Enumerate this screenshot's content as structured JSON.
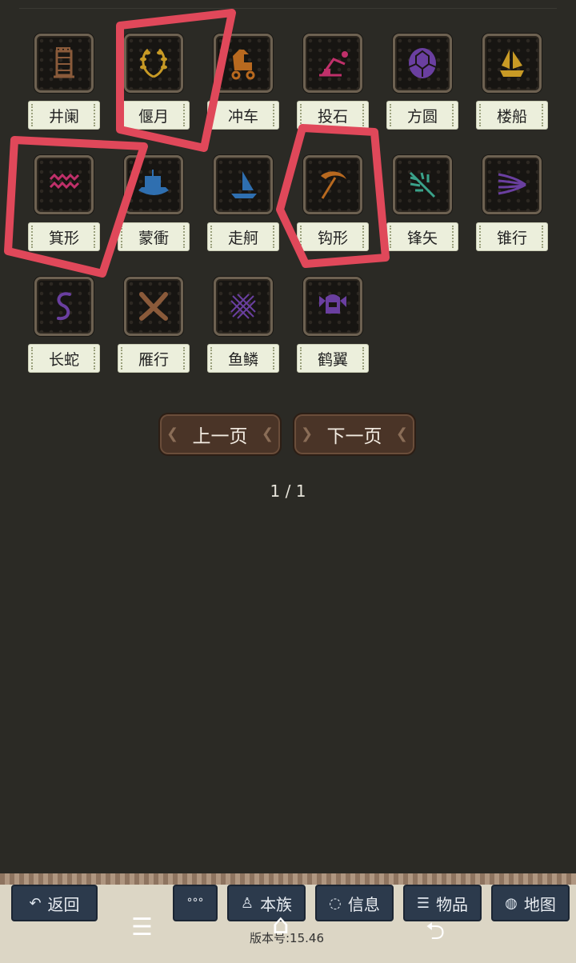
{
  "formations": [
    {
      "name": "井阑",
      "icon": "siege-tower-icon",
      "color": "#8a5a3a"
    },
    {
      "name": "偃月",
      "icon": "laurel-wreath-icon",
      "color": "#c89a25"
    },
    {
      "name": "冲车",
      "icon": "trojan-horse-icon",
      "color": "#b8691f"
    },
    {
      "name": "投石",
      "icon": "catapult-icon",
      "color": "#c0306a"
    },
    {
      "name": "方圆",
      "icon": "turtle-shell-icon",
      "color": "#6a3fa0"
    },
    {
      "name": "楼船",
      "icon": "sailing-ship-icon",
      "color": "#c89a25"
    },
    {
      "name": "箕形",
      "icon": "waves-icon",
      "color": "#c0306a"
    },
    {
      "name": "蒙衝",
      "icon": "longship-icon",
      "color": "#2f6fb0"
    },
    {
      "name": "走舸",
      "icon": "sailboat-icon",
      "color": "#2f6fb0"
    },
    {
      "name": "钩形",
      "icon": "scythe-icon",
      "color": "#b8691f"
    },
    {
      "name": "锋矢",
      "icon": "arrow-feather-icon",
      "color": "#3aa28a"
    },
    {
      "name": "锥行",
      "icon": "speed-lines-icon",
      "color": "#6a3fa0"
    },
    {
      "name": "长蛇",
      "icon": "snake-icon",
      "color": "#6a3fa0"
    },
    {
      "name": "雁行",
      "icon": "crossed-feathers-icon",
      "color": "#8a5a3a"
    },
    {
      "name": "鱼鳞",
      "icon": "fish-scale-icon",
      "color": "#6a3fa0"
    },
    {
      "name": "鹤翼",
      "icon": "winged-helmet-icon",
      "color": "#6a3fa0"
    }
  ],
  "pagination": {
    "prev": "上一页",
    "next": "下一页",
    "indicator": "1 / 1"
  },
  "toolbar": {
    "back": "返回",
    "more": "°°°",
    "clan": "本族",
    "info": "信息",
    "items": "物品",
    "map": "地图"
  },
  "version": "版本号:15.46",
  "annotation_color": "#e0485a"
}
